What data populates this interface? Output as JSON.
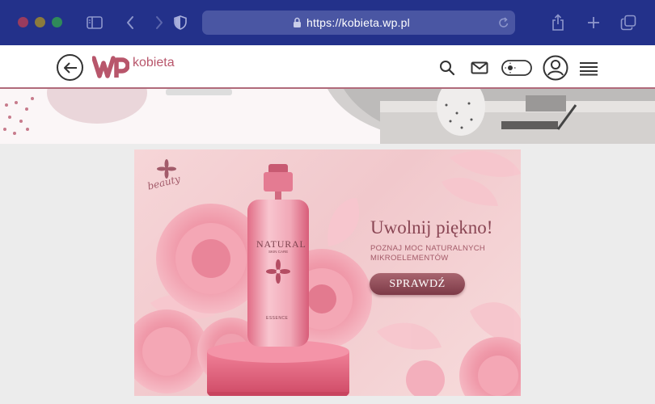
{
  "browser": {
    "url": "https://kobieta.wp.pl",
    "icons": [
      "sidebar-icon",
      "back-arrow-icon",
      "forward-arrow-icon",
      "shield-icon",
      "lock-icon",
      "reload-icon",
      "share-icon",
      "new-tab-icon",
      "tabs-icon"
    ]
  },
  "site": {
    "logo_text": "kobieta",
    "header_icons": [
      "back-icon",
      "search-icon",
      "mail-icon",
      "theme-toggle-icon",
      "user-icon",
      "menu-icon"
    ]
  },
  "banner": {
    "brand_script": "beauty",
    "headline": "Uwolnij piękno!",
    "subline": "POZNAJ MOC NATURALNYCH MIKROELEMENTÓW",
    "cta_label": "SPRAWDŹ",
    "bottle_title": "NATURAL",
    "bottle_subtitle": "SKIN CARE",
    "bottle_essence": "ESSENCE"
  },
  "colors": {
    "chrome": "#23318a",
    "urlbar": "#4a56a3",
    "brand": "#b8566b",
    "cta": "#8a4654"
  }
}
